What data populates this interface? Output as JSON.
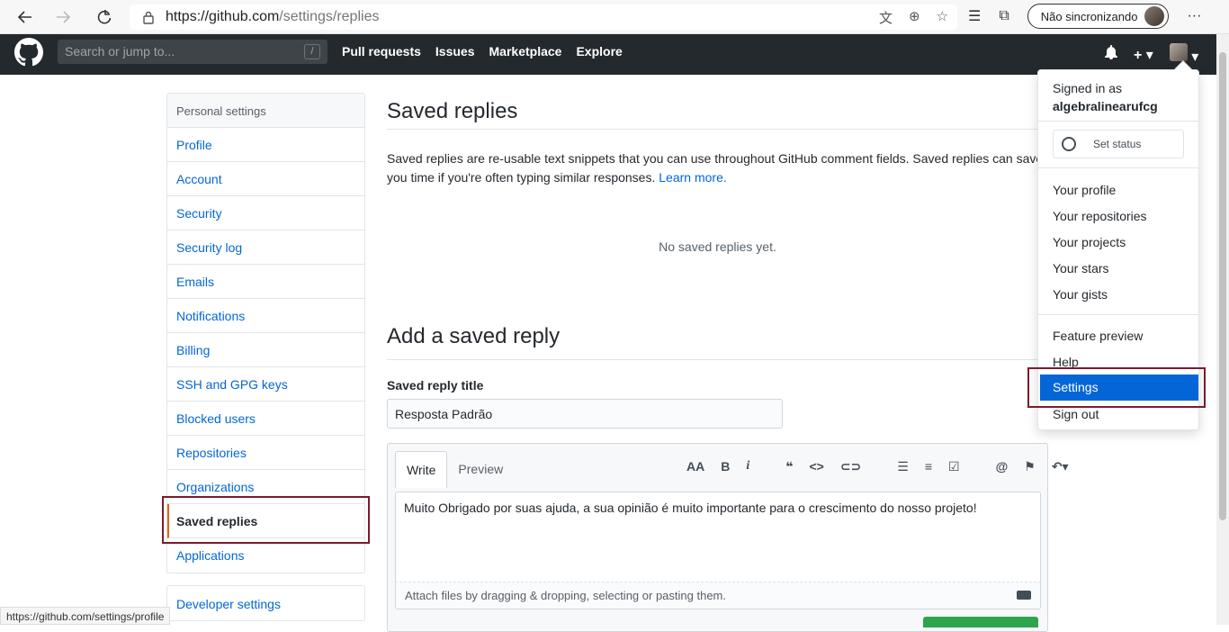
{
  "browser": {
    "url_host": "https://github.com",
    "url_path": "/settings/replies",
    "sync_label": "Não sincronizando",
    "status_url": "https://github.com/settings/profile"
  },
  "header": {
    "search_placeholder": "Search or jump to...",
    "search_shortcut": "/",
    "nav": [
      "Pull requests",
      "Issues",
      "Marketplace",
      "Explore"
    ],
    "plus": "+"
  },
  "sidebar": {
    "title": "Personal settings",
    "items": [
      {
        "label": "Profile"
      },
      {
        "label": "Account"
      },
      {
        "label": "Security"
      },
      {
        "label": "Security log"
      },
      {
        "label": "Emails"
      },
      {
        "label": "Notifications"
      },
      {
        "label": "Billing"
      },
      {
        "label": "SSH and GPG keys"
      },
      {
        "label": "Blocked users"
      },
      {
        "label": "Repositories"
      },
      {
        "label": "Organizations"
      },
      {
        "label": "Saved replies"
      },
      {
        "label": "Applications"
      }
    ],
    "developer": "Developer settings"
  },
  "main": {
    "title": "Saved replies",
    "description": "Saved replies are re-usable text snippets that you can use throughout GitHub comment fields. Saved replies can save you time if you're often typing similar responses.",
    "learn_more": "Learn more.",
    "empty": "No saved replies yet.",
    "add_title": "Add a saved reply",
    "field_label": "Saved reply title",
    "title_value": "Resposta Padrão",
    "tab_write": "Write",
    "tab_preview": "Preview",
    "body_value": "Muito Obrigado por suas ajuda, a sua opinião é muito importante para o crescimento do nosso projeto!",
    "attach_hint": "Attach files by dragging & dropping, selecting or pasting them."
  },
  "dropdown": {
    "signed_in_as": "Signed in as",
    "username": "algebralinearufcg",
    "set_status": "Set status",
    "items": [
      "Your profile",
      "Your repositories",
      "Your projects",
      "Your stars",
      "Your gists"
    ],
    "items2": [
      "Feature preview",
      "Help",
      "Settings",
      "Sign out"
    ]
  },
  "colors": {
    "header_bg": "#24292e",
    "link": "#0366d6",
    "highlight_box": "#7d1a2a",
    "selected_bar": "#e36209"
  }
}
